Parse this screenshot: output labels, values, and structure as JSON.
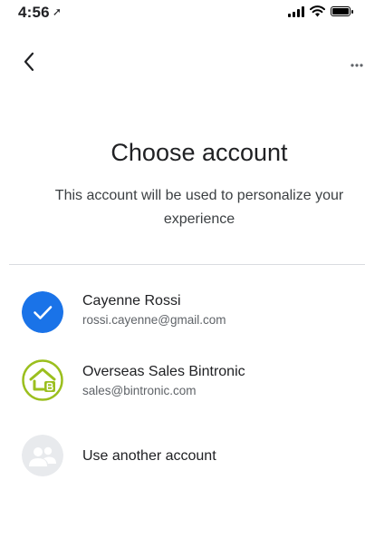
{
  "status_bar": {
    "time": "4:56",
    "location_arrow": "➚"
  },
  "header": {
    "title": "Choose account",
    "subtitle": "This account will be used to personalize your experience"
  },
  "accounts": [
    {
      "name": "Cayenne Rossi",
      "email": "rossi.cayenne@gmail.com",
      "avatar": "checkmark-icon",
      "avatar_color": "#1a73e8"
    },
    {
      "name": "Overseas Sales Bintronic",
      "email": "sales@bintronic.com",
      "avatar": "bintronic-logo",
      "avatar_color": "#9bbf1e"
    }
  ],
  "other_account": {
    "label": "Use another account",
    "avatar": "person-add-icon"
  }
}
